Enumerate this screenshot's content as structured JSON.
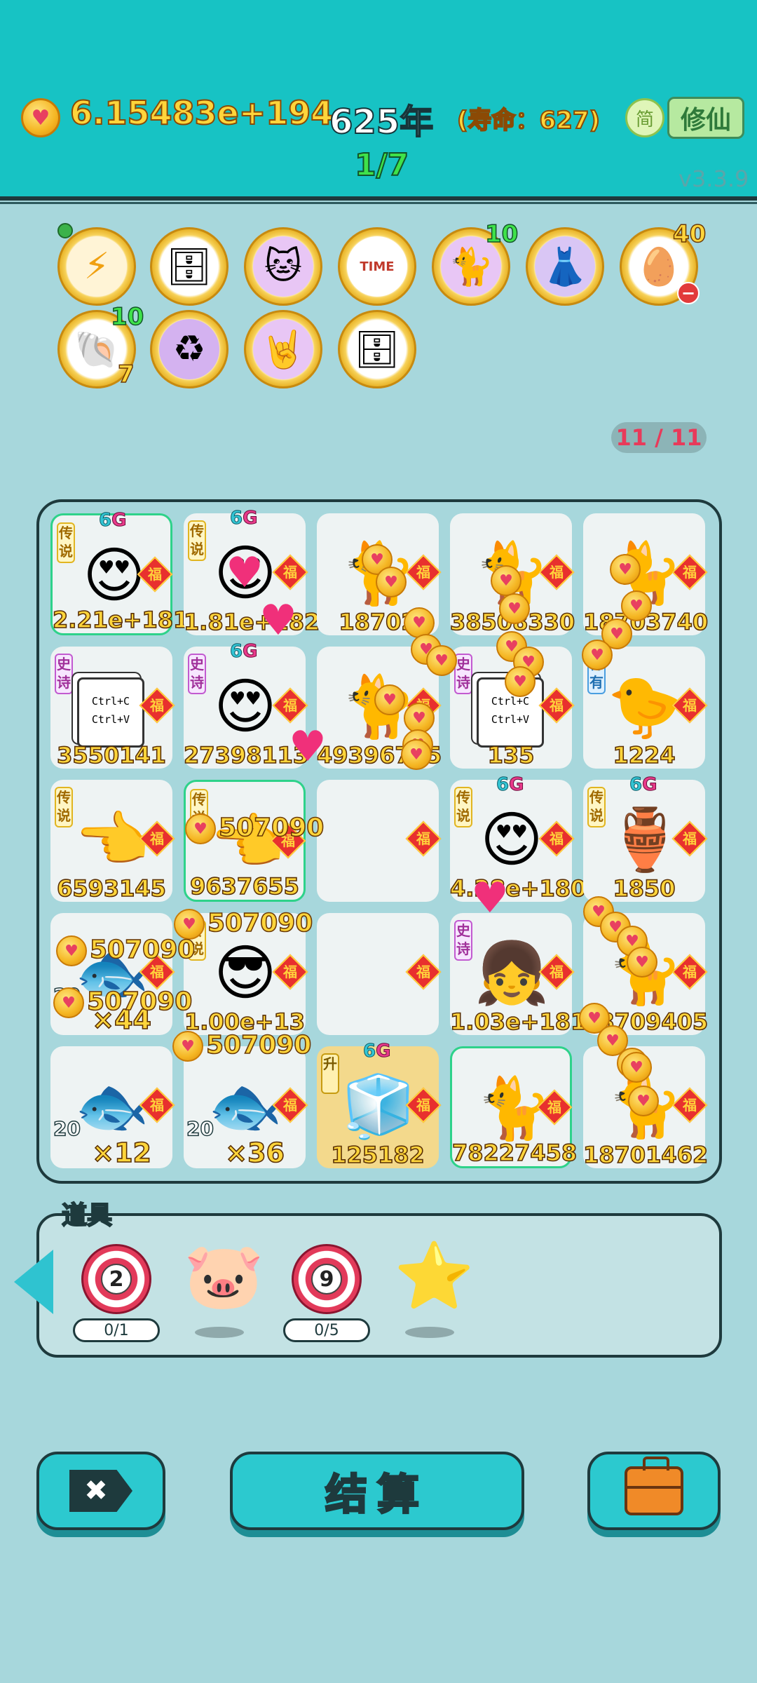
{
  "header": {
    "money": "6.15483e+194",
    "year": "625年",
    "lifespan": "(寿命：627)",
    "progress": "1/7",
    "simp_button": "简",
    "xiuxian_button": "修仙",
    "version": "v3.3.9"
  },
  "relics": [
    {
      "name": "lightning-relic-icon",
      "glyph": "⚡"
    },
    {
      "name": "safe-relic-icon",
      "glyph": "🗄"
    },
    {
      "name": "cat-sunglasses-relic-icon",
      "glyph": "🐱"
    },
    {
      "name": "time-magazine-relic-icon",
      "glyph": "TIME"
    },
    {
      "name": "cat-relic-icon",
      "glyph": "🐈",
      "count": "10"
    },
    {
      "name": "skirt-relic-icon",
      "glyph": "👗"
    },
    {
      "name": "egg-tray-relic-icon",
      "glyph": "🥚",
      "count": "40"
    },
    {
      "name": "shell-relic-icon",
      "glyph": "🐚",
      "count": "10",
      "count2": "7"
    },
    {
      "name": "recycle-relic-icon",
      "glyph": "♻"
    },
    {
      "name": "rock-hand-relic-icon",
      "glyph": "🤘"
    },
    {
      "name": "safe2-relic-icon",
      "glyph": "🗄"
    }
  ],
  "page_count": "11 / 11",
  "board": {
    "cells": [
      {
        "tag": "传说",
        "g6": true,
        "icon": "king-face-icon",
        "glyph": "😍",
        "value": "2.21e+181",
        "fu": true,
        "highlight": true
      },
      {
        "tag": "传说",
        "g6": true,
        "icon": "boy-face-icon",
        "glyph": "😍",
        "value": "1.81e+182",
        "fu": true
      },
      {
        "tag": "",
        "icon": "cat-icon",
        "glyph": "🐈",
        "value": "18702",
        "fu": true
      },
      {
        "tag": "",
        "icon": "cat-icon",
        "glyph": "🐈",
        "value": "38508330",
        "fu": true
      },
      {
        "tag": "",
        "icon": "cat-icon",
        "glyph": "🐈",
        "value": "18703740",
        "fu": true
      },
      {
        "tag": "史诗",
        "icon": "ctrl-copy-card-icon",
        "ctrl": true,
        "value": "3550141",
        "fu": true
      },
      {
        "tag": "史诗",
        "g6": true,
        "icon": "red-hat-face-icon",
        "glyph": "😍",
        "value": "27398113",
        "fu": true
      },
      {
        "tag": "",
        "icon": "cat-icon",
        "glyph": "🐈",
        "value": "49396725",
        "fu": true
      },
      {
        "tag": "史诗",
        "icon": "ctrl-copy-card-icon",
        "ctrl": true,
        "value": "135",
        "fu": true
      },
      {
        "tag": "稀有",
        "icon": "chick-icon",
        "glyph": "🐤",
        "value": "1224",
        "fu": true
      },
      {
        "tag": "传说",
        "icon": "pointing-hand-icon",
        "glyph": "👈",
        "value": "6593145",
        "fu": true
      },
      {
        "tag": "传说",
        "icon": "pointing-hand-icon",
        "glyph": "👈",
        "value": "9637655",
        "fu": true,
        "highlight": true
      },
      {
        "tag": "",
        "icon": "empty-slot",
        "glyph": "",
        "value": "",
        "fu": true
      },
      {
        "tag": "传说",
        "g6": true,
        "icon": "king-face-icon",
        "glyph": "😍",
        "value": "4.28e+180",
        "fu": true
      },
      {
        "tag": "传说",
        "g6": true,
        "icon": "green-vase-icon",
        "glyph": "🏺",
        "value": "1850",
        "fu": true
      },
      {
        "tag": "",
        "icon": "fish-icon",
        "glyph": "🐟",
        "small": "20",
        "mult": "×44",
        "value": "",
        "fu": true
      },
      {
        "tag": "传说",
        "icon": "cool-face-icon",
        "glyph": "😎",
        "value": "1.00e+13",
        "fu": true
      },
      {
        "tag": "",
        "icon": "empty-slot",
        "glyph": "",
        "value": "",
        "fu": true
      },
      {
        "tag": "史诗",
        "icon": "girl-face-icon",
        "glyph": "👧",
        "value": "1.03e+181",
        "fu": true
      },
      {
        "tag": "",
        "icon": "cat-icon",
        "glyph": "🐈",
        "value": "18709405",
        "fu": true
      },
      {
        "tag": "",
        "icon": "fish-icon",
        "glyph": "🐟",
        "small": "20",
        "mult": "×12",
        "value": "",
        "fu": true
      },
      {
        "tag": "",
        "icon": "fish-icon",
        "glyph": "🐟",
        "small": "20",
        "mult": "×36",
        "value": "",
        "fu": true
      },
      {
        "tag": "升",
        "g6": true,
        "icon": "fridge-icon",
        "glyph": "🧊",
        "value": "125182",
        "fu": true,
        "gold": true
      },
      {
        "tag": "",
        "icon": "cat-icon",
        "glyph": "🐈",
        "value": "78227458",
        "fu": true,
        "highlight": true
      },
      {
        "tag": "",
        "icon": "cat-icon",
        "glyph": "🐈",
        "value": "18701462",
        "fu": true
      }
    ],
    "fu_label": "福",
    "g6_label": "6",
    "g6_suffix": "G",
    "floating": [
      {
        "text": "507090"
      },
      {
        "text": "507090"
      },
      {
        "text": "507090"
      },
      {
        "text": "507090"
      },
      {
        "text": "507090"
      }
    ]
  },
  "items": {
    "title": "道具",
    "list": [
      {
        "name": "target-2-icon",
        "number": "2",
        "count": "0/1"
      },
      {
        "name": "piggy-bank-icon",
        "glyph": "🐷"
      },
      {
        "name": "target-9-icon",
        "number": "9",
        "count": "0/5"
      },
      {
        "name": "star-icon",
        "glyph": "⭐"
      }
    ]
  },
  "buttons": {
    "exit_label": "✖",
    "settle_label": "结算"
  }
}
